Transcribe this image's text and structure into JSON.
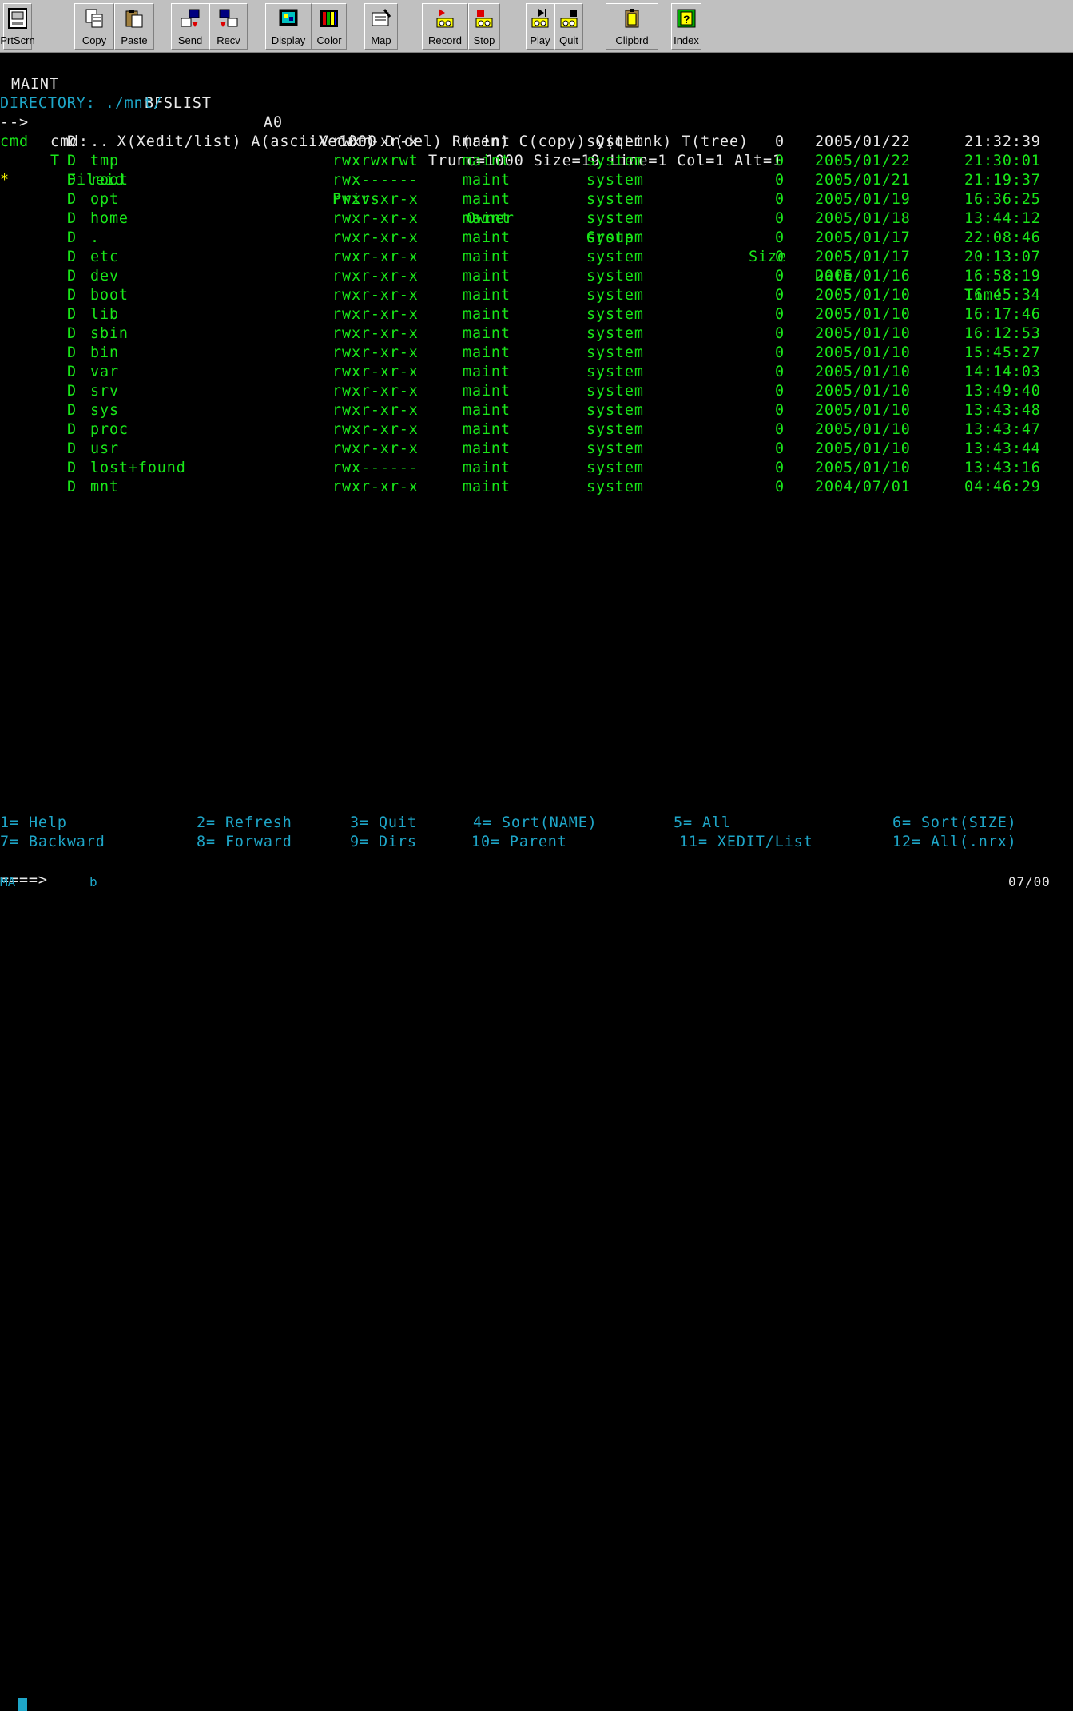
{
  "toolbar": {
    "buttons": [
      {
        "id": "prtscrn",
        "label": "PrtScrn",
        "icon": "printer-icon"
      },
      {
        "id": "copy",
        "label": "Copy",
        "icon": "copy-icon"
      },
      {
        "id": "paste",
        "label": "Paste",
        "icon": "paste-icon"
      },
      {
        "id": "send",
        "label": "Send",
        "icon": "send-icon"
      },
      {
        "id": "recv",
        "label": "Recv",
        "icon": "receive-icon"
      },
      {
        "id": "display",
        "label": "Display",
        "icon": "display-icon"
      },
      {
        "id": "color",
        "label": "Color",
        "icon": "color-icon"
      },
      {
        "id": "map",
        "label": "Map",
        "icon": "map-icon"
      },
      {
        "id": "record",
        "label": "Record",
        "icon": "record-icon"
      },
      {
        "id": "stop",
        "label": "Stop",
        "icon": "stop-icon"
      },
      {
        "id": "play",
        "label": "Play",
        "icon": "play-icon"
      },
      {
        "id": "quit",
        "label": "Quit",
        "icon": "quit-icon"
      },
      {
        "id": "clipbrd",
        "label": "Clipbrd",
        "icon": "clipboard-icon"
      },
      {
        "id": "index",
        "label": "Index",
        "icon": "index-help-icon"
      }
    ]
  },
  "header": {
    "userid": "MAINT",
    "filename": "BFSLIST",
    "filemode": "A0",
    "recfm": "V 1000",
    "info": "Trunc=1000 Size=19 Line=1 Col=1 Alt=1"
  },
  "directory_line": "DIRECTORY: ./mnt/",
  "cmd_legend": {
    "arrow": "-->",
    "text": "cmd:   X(Xedit/list) A(asciiXedit) D(del) R(ren) C(copy) Q(qLink) T(tree)"
  },
  "columns": {
    "cmd": "cmd",
    "type": "T",
    "fileid": "Fileid",
    "privs": "Privs",
    "owner": "Owner",
    "group": "Group",
    "size": "Size",
    "date": "Date",
    "time": "Time"
  },
  "files": [
    {
      "cmd": "",
      "type": "D",
      "name": "..",
      "privs": "rwxr-xr-x",
      "owner": "maint",
      "group": "system",
      "size": "0",
      "date": "2005/01/22",
      "time": "21:32:39",
      "current": true
    },
    {
      "cmd": "",
      "type": "D",
      "name": "tmp",
      "privs": "rwxrwxrwt",
      "owner": "maint",
      "group": "system",
      "size": "0",
      "date": "2005/01/22",
      "time": "21:30:01",
      "current": false
    },
    {
      "cmd": "*",
      "type": "D",
      "name": "root",
      "privs": "rwx------",
      "owner": "maint",
      "group": "system",
      "size": "0",
      "date": "2005/01/21",
      "time": "21:19:37",
      "current": false
    },
    {
      "cmd": "",
      "type": "D",
      "name": "opt",
      "privs": "rwxr-xr-x",
      "owner": "maint",
      "group": "system",
      "size": "0",
      "date": "2005/01/19",
      "time": "16:36:25",
      "current": false
    },
    {
      "cmd": "",
      "type": "D",
      "name": "home",
      "privs": "rwxr-xr-x",
      "owner": "maint",
      "group": "system",
      "size": "0",
      "date": "2005/01/18",
      "time": "13:44:12",
      "current": false
    },
    {
      "cmd": "",
      "type": "D",
      "name": ".",
      "privs": "rwxr-xr-x",
      "owner": "maint",
      "group": "system",
      "size": "0",
      "date": "2005/01/17",
      "time": "22:08:46",
      "current": false
    },
    {
      "cmd": "",
      "type": "D",
      "name": "etc",
      "privs": "rwxr-xr-x",
      "owner": "maint",
      "group": "system",
      "size": "0",
      "date": "2005/01/17",
      "time": "20:13:07",
      "current": false
    },
    {
      "cmd": "",
      "type": "D",
      "name": "dev",
      "privs": "rwxr-xr-x",
      "owner": "maint",
      "group": "system",
      "size": "0",
      "date": "2005/01/16",
      "time": "16:58:19",
      "current": false
    },
    {
      "cmd": "",
      "type": "D",
      "name": "boot",
      "privs": "rwxr-xr-x",
      "owner": "maint",
      "group": "system",
      "size": "0",
      "date": "2005/01/10",
      "time": "16:45:34",
      "current": false
    },
    {
      "cmd": "",
      "type": "D",
      "name": "lib",
      "privs": "rwxr-xr-x",
      "owner": "maint",
      "group": "system",
      "size": "0",
      "date": "2005/01/10",
      "time": "16:17:46",
      "current": false
    },
    {
      "cmd": "",
      "type": "D",
      "name": "sbin",
      "privs": "rwxr-xr-x",
      "owner": "maint",
      "group": "system",
      "size": "0",
      "date": "2005/01/10",
      "time": "16:12:53",
      "current": false
    },
    {
      "cmd": "",
      "type": "D",
      "name": "bin",
      "privs": "rwxr-xr-x",
      "owner": "maint",
      "group": "system",
      "size": "0",
      "date": "2005/01/10",
      "time": "15:45:27",
      "current": false
    },
    {
      "cmd": "",
      "type": "D",
      "name": "var",
      "privs": "rwxr-xr-x",
      "owner": "maint",
      "group": "system",
      "size": "0",
      "date": "2005/01/10",
      "time": "14:14:03",
      "current": false
    },
    {
      "cmd": "",
      "type": "D",
      "name": "srv",
      "privs": "rwxr-xr-x",
      "owner": "maint",
      "group": "system",
      "size": "0",
      "date": "2005/01/10",
      "time": "13:49:40",
      "current": false
    },
    {
      "cmd": "",
      "type": "D",
      "name": "sys",
      "privs": "rwxr-xr-x",
      "owner": "maint",
      "group": "system",
      "size": "0",
      "date": "2005/01/10",
      "time": "13:43:48",
      "current": false
    },
    {
      "cmd": "",
      "type": "D",
      "name": "proc",
      "privs": "rwxr-xr-x",
      "owner": "maint",
      "group": "system",
      "size": "0",
      "date": "2005/01/10",
      "time": "13:43:47",
      "current": false
    },
    {
      "cmd": "",
      "type": "D",
      "name": "usr",
      "privs": "rwxr-xr-x",
      "owner": "maint",
      "group": "system",
      "size": "0",
      "date": "2005/01/10",
      "time": "13:43:44",
      "current": false
    },
    {
      "cmd": "",
      "type": "D",
      "name": "lost+found",
      "privs": "rwx------",
      "owner": "maint",
      "group": "system",
      "size": "0",
      "date": "2005/01/10",
      "time": "13:43:16",
      "current": false
    },
    {
      "cmd": "",
      "type": "D",
      "name": "mnt",
      "privs": "rwxr-xr-x",
      "owner": "maint",
      "group": "system",
      "size": "0",
      "date": "2004/07/01",
      "time": "04:46:29",
      "current": false
    }
  ],
  "pfkeys": {
    "row1": [
      {
        "key": "1=",
        "label": "Help"
      },
      {
        "key": "2=",
        "label": "Refresh"
      },
      {
        "key": "3=",
        "label": "Quit"
      },
      {
        "key": "4=",
        "label": "Sort(NAME)"
      },
      {
        "key": "5=",
        "label": "All"
      },
      {
        "key": "6=",
        "label": "Sort(SIZE)"
      }
    ],
    "row2": [
      {
        "key": "7=",
        "label": "Backward"
      },
      {
        "key": "8=",
        "label": "Forward"
      },
      {
        "key": "9=",
        "label": "Dirs"
      },
      {
        "key": "10=",
        "label": "Parent"
      },
      {
        "key": "11=",
        "label": "XEDIT/List"
      },
      {
        "key": "12=",
        "label": "All(.nrx)"
      }
    ]
  },
  "command_prompt": "====>",
  "status": {
    "left": "MA",
    "indicator": "b",
    "cursor_pos": "07/00"
  },
  "colors": {
    "background": "#000000",
    "white_text": "#e8e8e8",
    "green_text": "#19e619",
    "cyan_text": "#1ea6c8",
    "yellow_text": "#f0f000",
    "toolbar_bg": "#c0c0c0"
  }
}
